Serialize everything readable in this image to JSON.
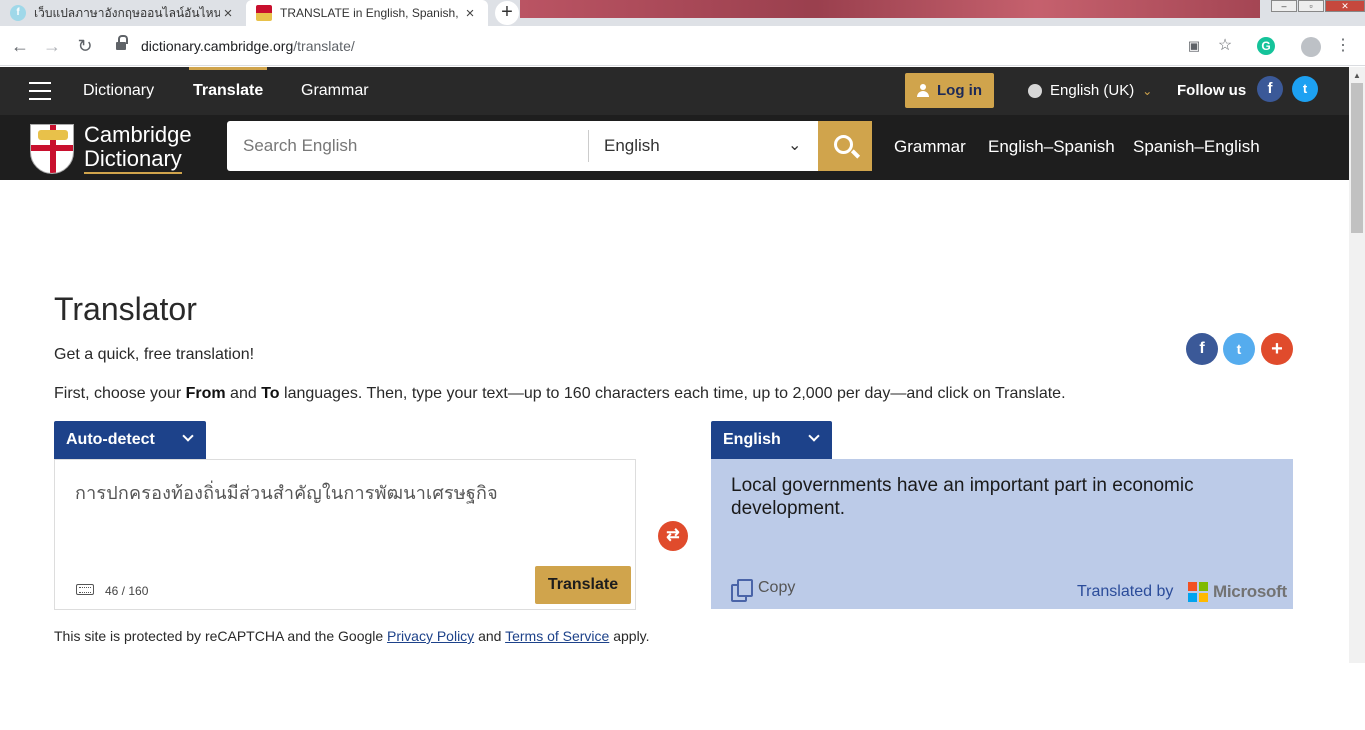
{
  "browser": {
    "tabs": [
      {
        "title": "เว็บแปลภาษาอังกฤษออนไลน์อันไหน",
        "close": "×",
        "favicon": "f"
      },
      {
        "title": "TRANSLATE in English, Spanish, F",
        "close": "×"
      }
    ],
    "new_tab": "+",
    "url_host": "dictionary.cambridge.org",
    "url_path": "/translate/",
    "grammarly": "G"
  },
  "header": {
    "nav": [
      "Dictionary",
      "Translate",
      "Grammar"
    ],
    "login": "Log in",
    "language": "English (UK)",
    "follow_us": "Follow us",
    "logo_line1": "Cambridge",
    "logo_line2": "Dictionary",
    "search_placeholder": "Search English",
    "dictionary_select": "English",
    "links": [
      "Grammar",
      "English–Spanish",
      "Spanish–English"
    ]
  },
  "main": {
    "title": "Translator",
    "subtitle": "Get a quick, free translation!",
    "instruction_1": "First, choose your ",
    "instruction_from": "From",
    "instruction_2": " and ",
    "instruction_to": "To",
    "instruction_3": " languages. Then, type your text—up to 160 characters each time, up to 2,000 per day—and click on Translate.",
    "from_language": "Auto-detect",
    "to_language": "English",
    "source_text": "การปกครองท้องถิ่นมีส่วนสำคัญในการพัฒนาเศรษฐกิจ",
    "char_count": "46 / 160",
    "translate_button": "Translate",
    "swap_symbol": "⇄",
    "translated_text": "Local governments have an important part in economic development.",
    "copy_label": "Copy",
    "translated_by": "Translated by",
    "provider": "Microsoft",
    "recaptcha_1": "This site is protected by reCAPTCHA and the Google ",
    "privacy_policy": "Privacy Policy",
    "recaptcha_2": " and ",
    "terms": "Terms of Service",
    "recaptcha_3": " apply."
  },
  "colors": {
    "header_dark": "#292929",
    "gold": "#d0a44c",
    "navy": "#1d428a",
    "target_bg": "#bccbe8",
    "swap_red": "#e04b2c",
    "facebook": "#3b5998",
    "twitter": "#1da1f2"
  },
  "icons": [
    "hamburger-icon",
    "user-icon",
    "globe-icon",
    "facebook-icon",
    "twitter-icon",
    "search-icon",
    "plus-icon",
    "keyboard-icon",
    "swap-icon",
    "copy-icon",
    "microsoft-logo"
  ]
}
